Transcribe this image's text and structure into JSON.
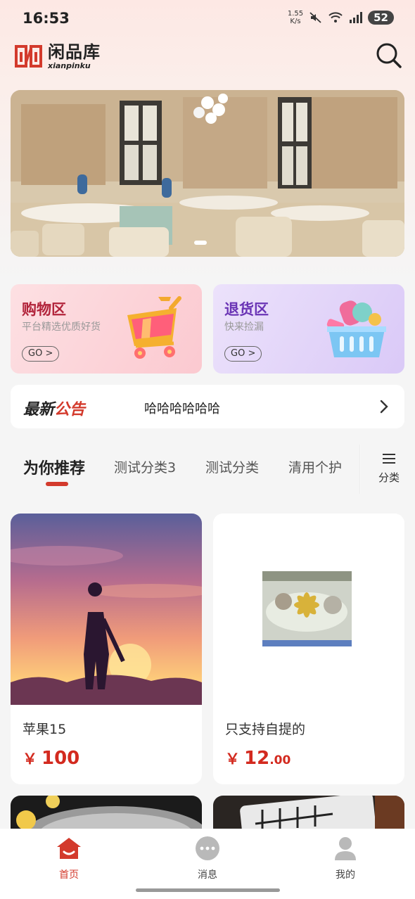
{
  "status_bar": {
    "time": "16:53",
    "net_speed_value": "1.55",
    "net_speed_unit": "K/s",
    "battery": "52"
  },
  "header": {
    "logo_name": "闲品库",
    "logo_sub": "xianpinku"
  },
  "zones": [
    {
      "title": "购物区",
      "subtitle": "平台精选优质好货",
      "button": "GO >"
    },
    {
      "title": "退货区",
      "subtitle": "快来捡漏",
      "button": "GO >"
    }
  ],
  "notice": {
    "title_part1": "最新",
    "title_part2": "公告",
    "text": "哈哈哈哈哈哈"
  },
  "tabs": {
    "items": [
      "为你推荐",
      "测试分类3",
      "测试分类",
      "清用个护"
    ],
    "active_index": 0,
    "category_label": "分类"
  },
  "products": [
    {
      "name": "苹果15",
      "currency": "￥",
      "price_int": "100",
      "price_dec": ""
    },
    {
      "name": "只支持自提的",
      "currency": "￥",
      "price_int": "12",
      "price_dec": ".00"
    }
  ],
  "bottom_nav": {
    "items": [
      {
        "label": "首页",
        "icon": "home-icon",
        "active": true
      },
      {
        "label": "消息",
        "icon": "message-icon",
        "active": false
      },
      {
        "label": "我的",
        "icon": "user-icon",
        "active": false
      }
    ]
  },
  "colors": {
    "accent": "#d33a2c",
    "price": "#d32a1f",
    "shop_zone_title": "#b2243b",
    "return_zone_title": "#6a34b5"
  }
}
